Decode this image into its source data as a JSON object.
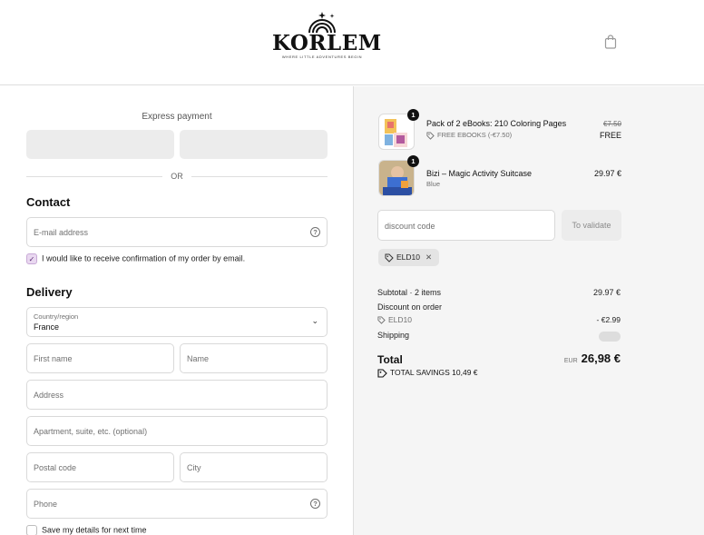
{
  "header": {
    "logo_text": "KORLEM",
    "logo_tagline": "WHERE LITTLE ADVENTURES BEGIN"
  },
  "express": {
    "title": "Express payment",
    "or_text": "OR"
  },
  "contact": {
    "title": "Contact",
    "email_placeholder": "E-mail address",
    "email_confirm_label": "I would like to receive confirmation of my order by email.",
    "email_confirm_checked": true
  },
  "delivery": {
    "title": "Delivery",
    "country_label": "Country/region",
    "country_value": "France",
    "first_name_placeholder": "First name",
    "name_placeholder": "Name",
    "address_placeholder": "Address",
    "apartment_placeholder": "Apartment, suite, etc. (optional)",
    "postal_code_placeholder": "Postal code",
    "city_placeholder": "City",
    "phone_placeholder": "Phone",
    "save_details_label": "Save my details for next time"
  },
  "cart": {
    "items": [
      {
        "qty": "1",
        "name": "Pack of 2 eBooks: 210 Coloring Pages",
        "sub": "FREE EBOOKS (-€7.50)",
        "original_price": "€7.50",
        "price": "FREE"
      },
      {
        "qty": "1",
        "name": "Bizi – Magic Activity Suitcase",
        "sub": "Blue",
        "price": "29.97 €"
      }
    ],
    "discount_placeholder": "discount code",
    "validate_label": "To validate",
    "applied_code": "ELD10",
    "subtotal_label": "Subtotal · 2 items",
    "subtotal_value": "29.97 €",
    "discount_label": "Discount on order",
    "discount_code": "ELD10",
    "discount_value": "- €2.99",
    "shipping_label": "Shipping",
    "total_label": "Total",
    "total_currency": "EUR",
    "total_value": "26,98 €",
    "savings_label": "TOTAL SAVINGS 10,49 €"
  },
  "colors": {
    "checkbox_accent": "#e9d8f0",
    "summary_bg": "#f5f5f5",
    "button_gray": "#ececec"
  }
}
